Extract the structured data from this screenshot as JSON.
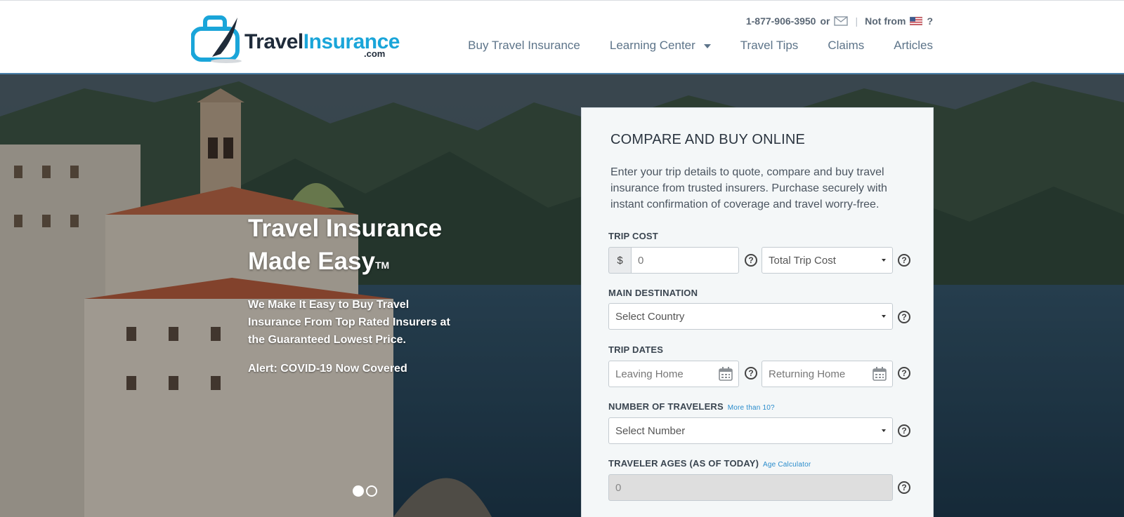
{
  "header": {
    "logo": {
      "word1": "Travel",
      "word2": "Insurance",
      "suffix": ".com"
    },
    "phone": "1-877-906-3950",
    "phone_or": "or",
    "not_from_label": "Not from",
    "not_from_suffix": "?",
    "nav": [
      {
        "label": "Buy Travel Insurance"
      },
      {
        "label": "Learning Center",
        "has_dropdown": true
      },
      {
        "label": "Travel Tips"
      },
      {
        "label": "Claims"
      },
      {
        "label": "Articles"
      }
    ]
  },
  "hero": {
    "title_line1": "Travel Insurance",
    "title_line2": "Made Easy",
    "trademark": "TM",
    "subtitle": "We Make It Easy to Buy Travel Insurance From Top Rated Insurers at the Guaranteed Lowest Price.",
    "alert": "Alert: COVID-19 Now Covered",
    "slides": {
      "count": 2,
      "active": 1
    }
  },
  "form": {
    "title": "COMPARE AND BUY ONLINE",
    "description": "Enter your trip details to quote, compare and buy travel insurance from trusted insurers. Purchase securely with instant confirmation of coverage and travel worry-free.",
    "trip_cost": {
      "label": "TRIP COST",
      "currency": "$",
      "placeholder": "0",
      "type_selected": "Total Trip Cost"
    },
    "destination": {
      "label": "MAIN DESTINATION",
      "selected": "Select Country"
    },
    "trip_dates": {
      "label": "TRIP DATES",
      "leaving_placeholder": "Leaving Home",
      "returning_placeholder": "Returning Home"
    },
    "travelers": {
      "label": "NUMBER OF TRAVELERS",
      "link": "More than 10?",
      "selected": "Select Number"
    },
    "ages": {
      "label": "TRAVELER AGES (AS OF TODAY)",
      "link": "Age Calculator",
      "value": "0"
    },
    "help_glyph": "?"
  },
  "colors": {
    "brand_blue": "#1aa5d9",
    "brand_dark": "#1f2b3a",
    "nav_text": "#5d7489",
    "link": "#2a8ccc"
  }
}
